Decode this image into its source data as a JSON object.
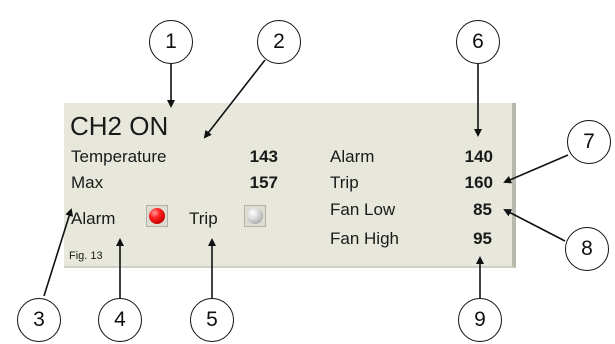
{
  "panel": {
    "title": "CH2 ON",
    "temperature_label": "Temperature",
    "temperature_value": "143",
    "max_label": "Max",
    "max_value": "157",
    "alarm_led_label": "Alarm",
    "trip_led_label": "Trip",
    "alarm_label": "Alarm",
    "alarm_value": "140",
    "trip_label": "Trip",
    "trip_value": "160",
    "fan_low_label": "Fan Low",
    "fan_low_value": "85",
    "fan_high_label": "Fan High",
    "fan_high_value": "95",
    "alarm_led_state": "on",
    "alarm_led_color": "#ff1e1e",
    "trip_led_state": "off",
    "trip_led_color": "#c0c0c0",
    "background_color": "#e8e7dc"
  },
  "figure_caption": "Fig. 13",
  "callouts": [
    "1",
    "2",
    "3",
    "4",
    "5",
    "6",
    "7",
    "8",
    "9"
  ]
}
